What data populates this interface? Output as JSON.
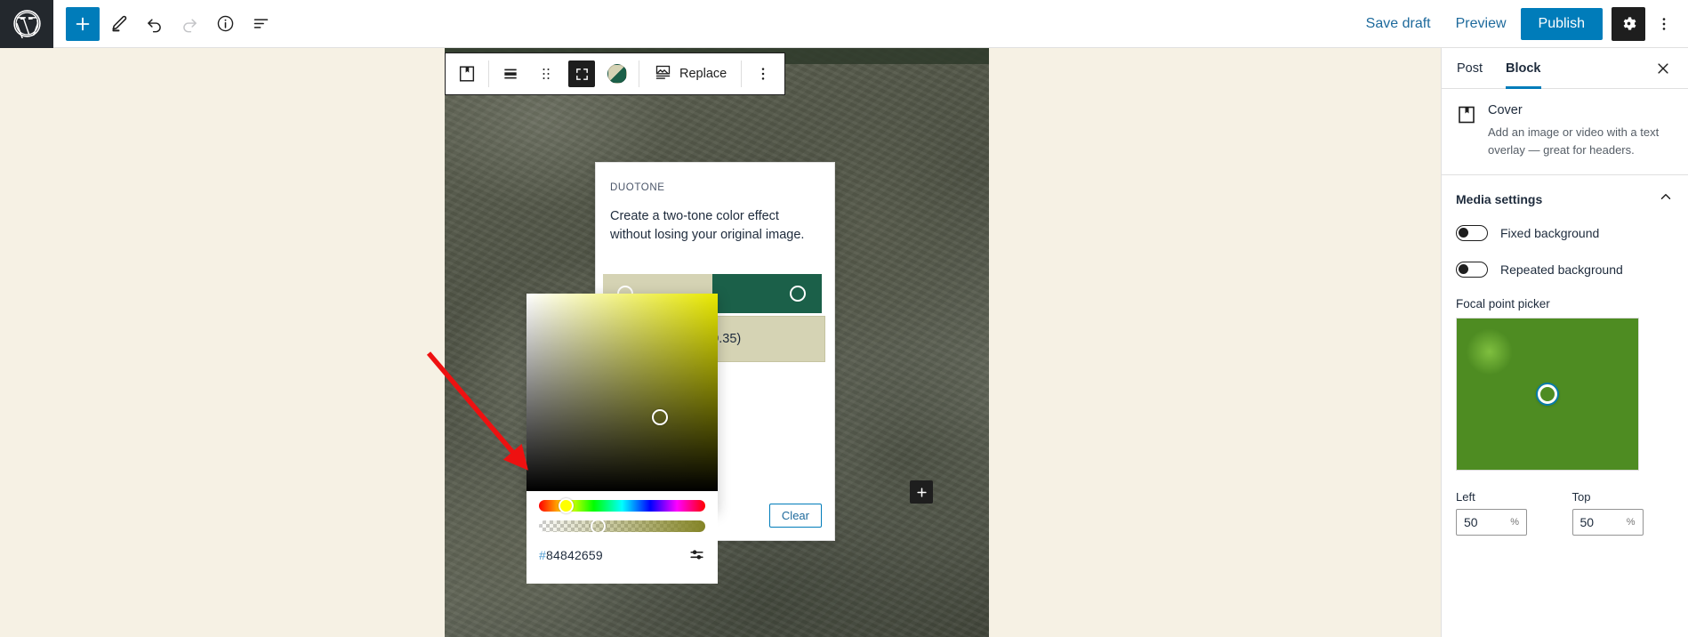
{
  "topbar": {
    "logo_icon": "wordpress-logo-icon",
    "left_tools": [
      {
        "name": "add-block-button",
        "icon": "plus-icon",
        "state": "primary"
      },
      {
        "name": "edit-tool-button",
        "icon": "pencil-icon",
        "state": "default"
      },
      {
        "name": "undo-button",
        "icon": "undo-arrow-icon",
        "state": "default"
      },
      {
        "name": "redo-button",
        "icon": "redo-arrow-icon",
        "state": "disabled"
      },
      {
        "name": "details-button",
        "icon": "info-circle-icon",
        "state": "default"
      },
      {
        "name": "list-view-button",
        "icon": "list-view-icon",
        "state": "default"
      }
    ],
    "save_draft_label": "Save draft",
    "preview_label": "Preview",
    "publish_label": "Publish",
    "settings_icon": "gear-icon",
    "more_icon": "ellipsis-vertical-icon"
  },
  "block_toolbar": {
    "block_type_icon": "cover-block-icon",
    "align_icon": "align-full-icon",
    "drag_icon": "drag-handle-icon",
    "fullscreen_icon": "expand-fullwidth-icon",
    "duotone_icon": "duotone-swatch-icon",
    "replace_icon": "media-replace-icon",
    "replace_label": "Replace",
    "more_icon": "ellipsis-vertical-icon"
  },
  "duotone_popover": {
    "heading": "DUOTONE",
    "description": "Create a two-tone color effect without losing your original image.",
    "shadow_color": "#d5d3b4",
    "highlight_color": "#1b6049",
    "rgba_value": "A(132, 132, 38, 0.35)",
    "swatch_circles": [
      "#d3cfc2",
      "#f0ebdb"
    ],
    "clear_label": "Clear"
  },
  "color_picker": {
    "hex_hash": "#",
    "hex_value": "84842659",
    "settings_icon": "sliders-icon",
    "hue_knob_color": "#ffff00",
    "selected_color_rgba": "rgba(132, 132, 38, 0.35)"
  },
  "canvas": {
    "background_color": "#f6f1e4",
    "cover_appender_icon": "plus-icon"
  },
  "sidebar": {
    "tabs": [
      {
        "label": "Post",
        "active": false
      },
      {
        "label": "Block",
        "active": true
      }
    ],
    "close_icon": "close-x-icon",
    "block_card": {
      "icon": "cover-block-icon",
      "title": "Cover",
      "description": "Add an image or video with a text overlay — great for headers."
    },
    "panel": {
      "title": "Media settings",
      "collapse_icon": "chevron-up-icon",
      "toggles": [
        {
          "label": "Fixed background",
          "on": false
        },
        {
          "label": "Repeated background",
          "on": false
        }
      ],
      "focal_point_label": "Focal point picker",
      "focal_inputs": [
        {
          "label": "Left",
          "value": "50",
          "unit": "%"
        },
        {
          "label": "Top",
          "value": "50",
          "unit": "%"
        }
      ]
    }
  },
  "annotation": {
    "arrow_color": "#ee1111",
    "points_to": "color-picker-hue-slider"
  }
}
